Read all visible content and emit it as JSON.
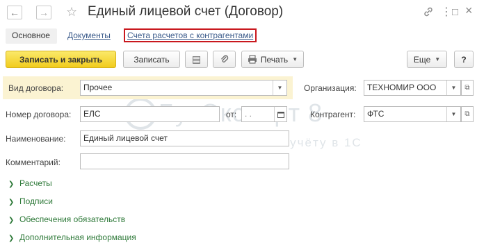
{
  "window": {
    "title": "Единый лицевой счет (Договор)",
    "icons": [
      "back-arrow-icon",
      "forward-arrow-icon",
      "star-icon",
      "link-icon",
      "more-vertical-icon",
      "maximize-icon",
      "close-icon"
    ],
    "back_glyph": "←",
    "forward_glyph": "→",
    "star_glyph": "☆",
    "link_glyph": "🔗",
    "more_glyph": "⋮",
    "maximize_glyph": "□",
    "close_glyph": "×"
  },
  "tabs": {
    "main": "Основное",
    "documents": "Документы",
    "settlements": "Счета расчетов с контрагентами"
  },
  "toolbar": {
    "save_close": "Записать и закрыть",
    "save": "Записать",
    "list_glyph": "▤",
    "attach_glyph": "⌀",
    "print": "Печать",
    "print_glyph": "🖶",
    "more": "Еще",
    "help": "?"
  },
  "form": {
    "contract_type_label": "Вид договора:",
    "contract_type_value": "Прочее",
    "organization_label": "Организация:",
    "organization_value": "ТЕХНОМИР ООО",
    "contract_number_label": "Номер договора:",
    "contract_number_value": "ЕЛС",
    "date_label": "от:",
    "date_value": " .  .",
    "counterparty_label": "Контрагент:",
    "counterparty_value": "ФТС",
    "name_label": "Наименование:",
    "name_value": "Единый лицевой счет",
    "comment_label": "Комментарий:",
    "comment_value": ""
  },
  "groups": [
    "Расчеты",
    "Подписи",
    "Обеспечения обязательств",
    "Дополнительная информация"
  ],
  "watermark": {
    "brand": "БухЭксперт 8",
    "tagline": "База ответов по учёту в 1С"
  },
  "colors": {
    "accent_yellow": "#f1cc1d",
    "highlight_red": "#c9181e",
    "group_green": "#2f7a3a",
    "link_blue": "#3a5a8a",
    "row_highlight": "#fbf3d2"
  }
}
